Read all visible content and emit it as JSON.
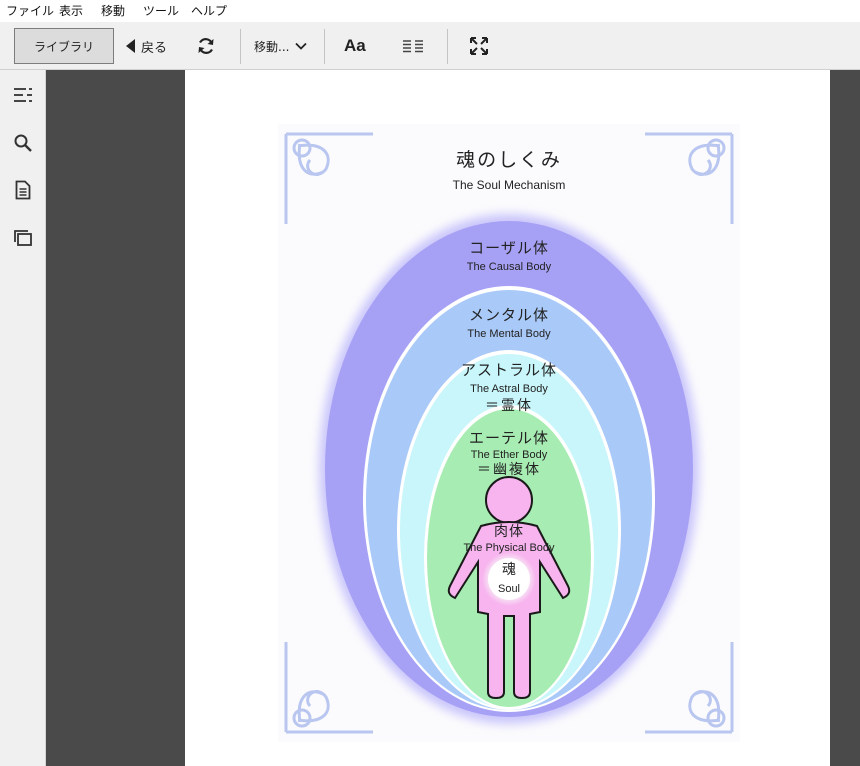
{
  "menu": [
    "ファイル",
    "表示",
    "移動",
    "ツール",
    "ヘルプ"
  ],
  "toolbar": {
    "library_label": "ライブラリ",
    "back_label": "戻る",
    "goto_label": "移動...",
    "font_label": "Aa"
  },
  "sidebar": {
    "icons": [
      "toc-icon",
      "search-icon",
      "document-icon",
      "layers-icon"
    ]
  },
  "figure": {
    "title_jp": "魂のしくみ",
    "title_en": "The Soul Mechanism",
    "layers": [
      {
        "jp": "コーザル体",
        "en": "The Causal Body",
        "eq": ""
      },
      {
        "jp": "メンタル体",
        "en": "The Mental Body",
        "eq": ""
      },
      {
        "jp": "アストラル体",
        "en": "The Astral Body",
        "eq": "＝霊体"
      },
      {
        "jp": "エーテル体",
        "en": "The Ether Body",
        "eq": "＝幽複体"
      },
      {
        "jp": "肉体",
        "en": "The Physical Body",
        "eq": ""
      }
    ],
    "soul_jp": "魂",
    "soul_en": "Soul"
  },
  "colors": {
    "causal": "#a9a3f7",
    "mental": "#a8c8f8",
    "astral": "#c7f7fa",
    "ether": "#a7ecb2",
    "physical": "#f7b4ee",
    "ornament": "#b8c6f0"
  }
}
